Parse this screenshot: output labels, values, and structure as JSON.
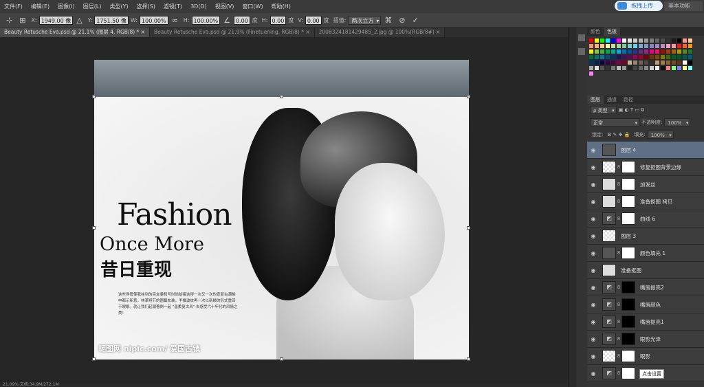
{
  "menu": [
    "文件(F)",
    "编辑(E)",
    "图像(I)",
    "图层(L)",
    "类型(Y)",
    "选择(S)",
    "滤镜(T)",
    "3D(D)",
    "视图(V)",
    "窗口(W)",
    "帮助(H)"
  ],
  "options": {
    "x_label": "X:",
    "x_value": "1949.00 像",
    "y_label": "Y:",
    "y_value": "1751.50 像",
    "w_label": "W:",
    "w_value": "100.00%",
    "h_label": "H:",
    "h_value": "100.00%",
    "angle_value": "0.00",
    "angle_unit": "度",
    "hskew_label": "H:",
    "hskew_value": "0.00",
    "hskew_unit": "度",
    "vskew_label": "V:",
    "vskew_value": "0.00",
    "vskew_unit": "度",
    "interp_label": "插值:",
    "interp_value": "两次立方",
    "upload_label": "拖拽上传",
    "basic_label": "基本功能"
  },
  "tabs": [
    {
      "label": "Beauty Retusche Eva.psd @ 21.1% (图层 4, RGB/8) *  ×"
    },
    {
      "label": "Beauty Retusche Eva.psd @ 21.9% (Finetuening, RGB/8) *  ×"
    },
    {
      "label": "2008324181429485_2.jpg @ 100%(RGB/8#)  ×"
    }
  ],
  "canvas": {
    "title": "Fashion",
    "subtitle": "Once More",
    "title_cn": "昔日重现",
    "body": "这些得管使我挂到的完女委和写时尚给接这得一次又一次的宣复古潮相申都示新意，林革翔节的圆幕女装，手推波纹再一次以新颖的形式重回于眼眼。就让我们起潮著倒一起 \"温柔复古风\" 去感受六十年代的风情之美！",
    "watermark": "昵图网 nipic.com/ 爱国古镇"
  },
  "status": "21.09%   文档:34.9M/272.1M",
  "panel": {
    "swatch_tabs": [
      "颜色",
      "色板"
    ],
    "layer_tabs": [
      "图层",
      "通道",
      "路径"
    ],
    "kind_label": "ρ 类型",
    "blend_mode": "正常",
    "opacity_label": "不透明度:",
    "opacity_value": "100%",
    "lock_label": "锁定:",
    "fill_label": "填充:",
    "fill_value": "100%"
  },
  "swatch_colors": [
    "#ff0000",
    "#ffff00",
    "#00ff00",
    "#00ffff",
    "#0000ff",
    "#ff00ff",
    "#ffffff",
    "#e6e6e6",
    "#cccccc",
    "#b3b3b3",
    "#999999",
    "#808080",
    "#666666",
    "#4d4d4d",
    "#333333",
    "#1a1a1a",
    "#000000",
    "#ff9999",
    "#ffcc99",
    "#f7977a",
    "#f9ad81",
    "#fdc68a",
    "#fff79a",
    "#c4df9b",
    "#a2d39c",
    "#82ca9d",
    "#7bcdc8",
    "#6ecff6",
    "#7ea7d8",
    "#8493ca",
    "#8882be",
    "#a187be",
    "#bc8dbf",
    "#f49ac2",
    "#f6989d",
    "#ed1c24",
    "#f26522",
    "#f7941d",
    "#fff200",
    "#8dc63f",
    "#39b54a",
    "#00a651",
    "#00a99d",
    "#00aeef",
    "#0072bc",
    "#0054a6",
    "#2e3192",
    "#662d91",
    "#92278f",
    "#ec008c",
    "#ed145b",
    "#9e0b0f",
    "#a0410d",
    "#a36209",
    "#aba000",
    "#598527",
    "#197b30",
    "#007236",
    "#00746b",
    "#0076a3",
    "#004b80",
    "#003471",
    "#1b1464",
    "#440e62",
    "#630460",
    "#9e005d",
    "#9e0039",
    "#790000",
    "#7b2e00",
    "#7d4900",
    "#827b00",
    "#406618",
    "#005e20",
    "#005826",
    "#005952",
    "#005b7f",
    "#003663",
    "#002157",
    "#0d004c",
    "#32004b",
    "#4b0049",
    "#7b0046",
    "#7a0026",
    "#c7b299",
    "#998675",
    "#736357",
    "#534741",
    "#37302a",
    "#c69c6d",
    "#a67c52",
    "#8c6239",
    "#754c24",
    "#603913",
    "#ffffff",
    "#000000",
    "#aaaaaa",
    "#dddddd",
    "#555555",
    "#333333",
    "#777777",
    "#bbbbbb",
    "#999999",
    "#222222",
    "#444444",
    "#666666",
    "#888888",
    "#cccccc",
    "#eeeeee",
    "#111111",
    "#ff8080",
    "#80ff80",
    "#8080ff",
    "#ffff80",
    "#80ffff",
    "#ff80ff"
  ],
  "layers": [
    {
      "name": "图层 4",
      "thumb": "dark",
      "mask": "",
      "active": true
    },
    {
      "name": "修复抠图背景边缘",
      "thumb": "check",
      "mask": "white",
      "active": false
    },
    {
      "name": "加发丝",
      "thumb": "",
      "mask": "white",
      "active": false
    },
    {
      "name": "准备抠图 拷贝",
      "thumb": "",
      "mask": "white",
      "active": false
    },
    {
      "name": "曲线 6",
      "thumb": "adj",
      "mask": "white",
      "active": false
    },
    {
      "name": "图层 3",
      "thumb": "check",
      "mask": "",
      "active": false
    },
    {
      "name": "颜色填充 1",
      "thumb": "dark",
      "mask": "white",
      "active": false
    },
    {
      "name": "准备抠图",
      "thumb": "",
      "mask": "",
      "active": false
    },
    {
      "name": "嘴唇提亮2",
      "thumb": "adj",
      "mask": "black",
      "active": false
    },
    {
      "name": "嘴唇颜色",
      "thumb": "adj",
      "mask": "black",
      "active": false
    },
    {
      "name": "嘴唇提亮1",
      "thumb": "adj",
      "mask": "black",
      "active": false
    },
    {
      "name": "眼影光泽",
      "thumb": "adj",
      "mask": "black",
      "active": false
    },
    {
      "name": "眼影",
      "thumb": "check",
      "mask": "white",
      "active": false
    },
    {
      "name": "二次锐化",
      "thumb": "adj",
      "mask": "white",
      "active": false
    }
  ],
  "tooltip": "点击设置"
}
